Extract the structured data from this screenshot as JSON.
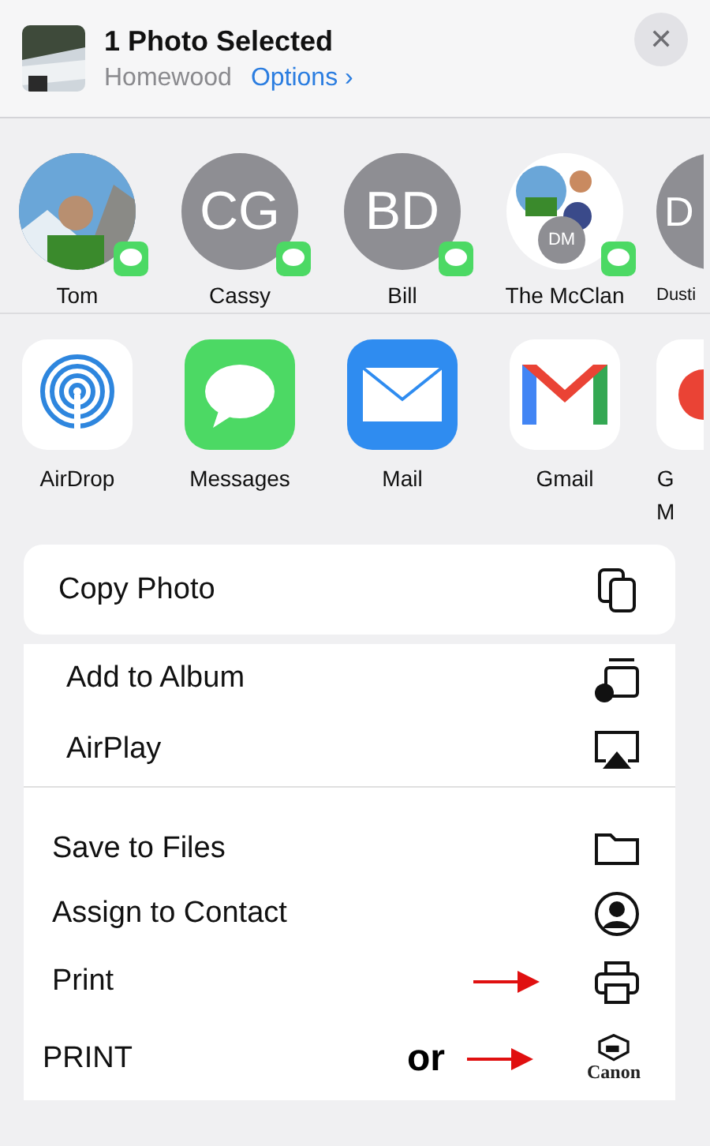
{
  "header": {
    "title": "1 Photo Selected",
    "location": "Homewood",
    "options_link": "Options",
    "options_chevron": "›",
    "close": "✕"
  },
  "people": [
    {
      "name": "Tom"
    },
    {
      "name": "Cassy",
      "kind": "initials",
      "initials": "CG"
    },
    {
      "name": "Bill",
      "kind": "initials",
      "initials": "BD"
    },
    {
      "name": "The McClan",
      "kind": "group",
      "initials": "DM"
    },
    {
      "name": "Dusti",
      "kind": "initials",
      "initials": "D"
    }
  ],
  "apps": [
    {
      "lines": [
        "AirDrop"
      ],
      "kind": "airdrop"
    },
    {
      "lines": [
        "Messages"
      ],
      "kind": "messages"
    },
    {
      "lines": [
        "Mail"
      ],
      "kind": "mail"
    },
    {
      "lines": [
        "Gmail"
      ],
      "kind": "gmail"
    },
    {
      "lines": [
        "G",
        "M"
      ],
      "kind": "google"
    }
  ],
  "action_groups": [
    [
      {
        "label": "Copy Photo"
      }
    ],
    [
      {
        "label": "Add to Album"
      },
      {
        "label": "AirPlay"
      }
    ],
    [
      {
        "label": "Save to Files"
      },
      {
        "label": "Assign to Contact"
      },
      {
        "label": "Print",
        "arrow": true
      },
      {
        "label": "PRINT",
        "arrow": true,
        "note": "or",
        "logo": "Canon"
      }
    ]
  ]
}
